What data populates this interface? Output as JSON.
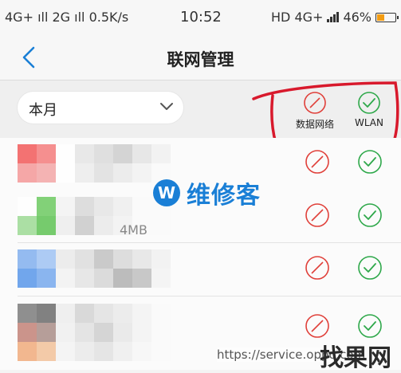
{
  "status_bar": {
    "left_text": "4G+ ıll 2G ıll 0.5K/s",
    "time": "10:52",
    "network": "HD 4G+",
    "battery": "46%",
    "battery_level": 0.46
  },
  "header": {
    "title": "联网管理"
  },
  "filter": {
    "period": "本月"
  },
  "columns": {
    "mobile_data": "数据网络",
    "wlan": "WLAN"
  },
  "rows": [
    {
      "usage": "",
      "mobile_data": "blocked",
      "wlan": "allowed"
    },
    {
      "usage": "4MB",
      "mobile_data": "blocked",
      "wlan": "allowed"
    },
    {
      "usage": "",
      "mobile_data": "blocked",
      "wlan": "allowed"
    },
    {
      "usage": "",
      "mobile_data": "blocked",
      "wlan": "allowed"
    }
  ],
  "watermark": {
    "logo_letter": "W",
    "text": "维修客",
    "url": "https://service.oppo.com",
    "brand": "找果网"
  },
  "colors": {
    "blocked": "#e0403a",
    "allowed": "#2ea84a",
    "accent": "#1a7fd6",
    "annotation": "#d8192c"
  }
}
